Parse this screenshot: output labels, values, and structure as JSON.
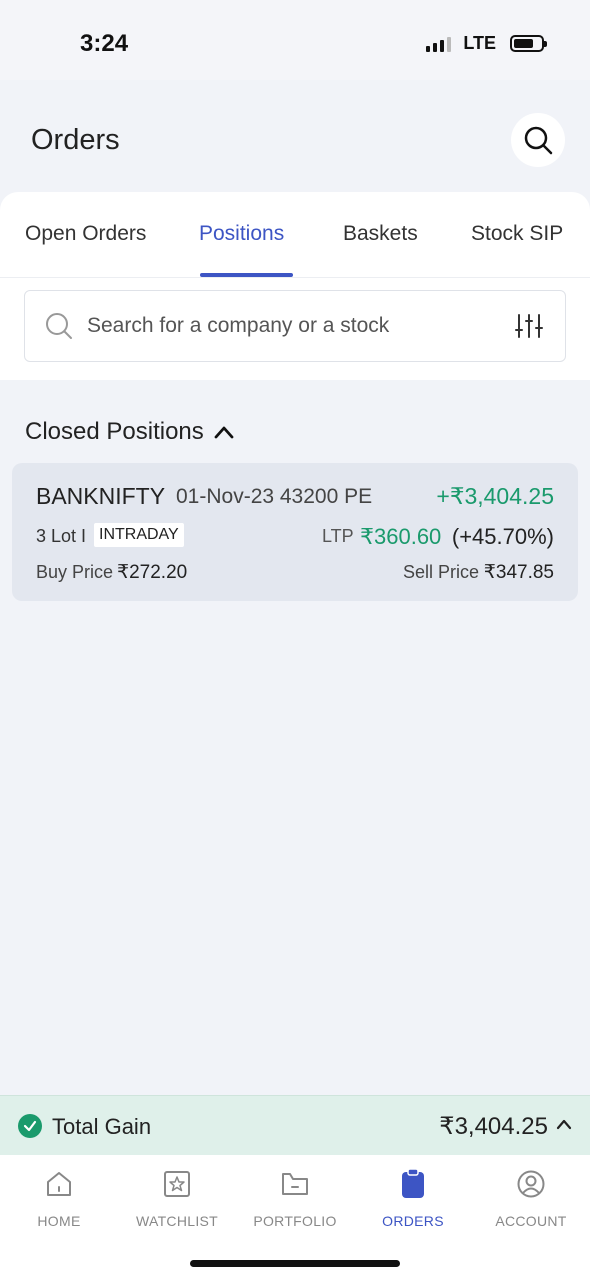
{
  "status_bar": {
    "time": "3:24",
    "network": "LTE"
  },
  "header": {
    "title": "Orders"
  },
  "tabs": [
    {
      "label": "Open Orders"
    },
    {
      "label": "Positions"
    },
    {
      "label": "Baskets"
    },
    {
      "label": "Stock SIP"
    }
  ],
  "search": {
    "placeholder": "Search for a company or a stock"
  },
  "section": {
    "title": "Closed Positions"
  },
  "position": {
    "symbol": "BANKNIFTY",
    "contract": "01-Nov-23 43200 PE",
    "pnl": "+₹3,404.25",
    "lot": "3 Lot I",
    "product": "INTRADAY",
    "ltp_label": "LTP",
    "ltp": "₹360.60",
    "change": "(+45.70%)",
    "buy_label": "Buy Price",
    "buy_price": "₹272.20",
    "sell_label": "Sell Price",
    "sell_price": "₹347.85"
  },
  "summary": {
    "label": "Total Gain",
    "value": "₹3,404.25"
  },
  "nav": [
    {
      "label": "HOME",
      "icon": "home-icon"
    },
    {
      "label": "WATCHLIST",
      "icon": "star-icon"
    },
    {
      "label": "PORTFOLIO",
      "icon": "folder-icon"
    },
    {
      "label": "ORDERS",
      "icon": "clipboard-icon"
    },
    {
      "label": "ACCOUNT",
      "icon": "user-icon"
    }
  ],
  "colors": {
    "accent": "#3d55c4",
    "gain": "#1a9a6c"
  }
}
